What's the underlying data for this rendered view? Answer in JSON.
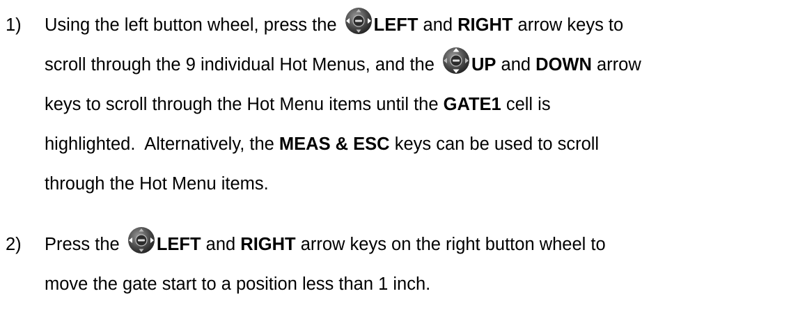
{
  "steps": [
    {
      "number": "1)",
      "line1": {
        "t1": "Using the left button wheel, press the ",
        "k1": "LEFT",
        "t2": " and ",
        "k2": "RIGHT",
        "t3": " arrow keys to"
      },
      "line2": {
        "t1": "scroll through the 9 individual Hot Menus, and the ",
        "k1": "UP",
        "t2": " and ",
        "k2": "DOWN",
        "t3": " arrow"
      },
      "line3": {
        "t1": "keys to scroll through the Hot Menu items until the ",
        "k1": "GATE1",
        "t2": " cell is"
      },
      "line4": {
        "t1": "highlighted.  Alternatively, the ",
        "k1": "MEAS & ESC",
        "t2": " keys can be used to scroll"
      },
      "line5": {
        "t1": "through the Hot Menu items."
      },
      "icons": {
        "left_right_wheel": "button-wheel-left-right-icon",
        "up_down_wheel": "button-wheel-up-down-icon"
      }
    },
    {
      "number": "2)",
      "line1": {
        "t1": "Press the ",
        "k1": "LEFT",
        "t2": " and ",
        "k2": "RIGHT",
        "t3": " arrow keys on the right button wheel to"
      },
      "line2": {
        "t1": "move the gate start to a position less than 1 inch."
      },
      "icons": {
        "left_right_wheel": "button-wheel-left-right-icon"
      }
    }
  ],
  "colors": {
    "text": "#000000",
    "wheel_body": "#3a3a3a",
    "wheel_highlight": "#ffffff",
    "arrow_active": "#ffffff"
  }
}
